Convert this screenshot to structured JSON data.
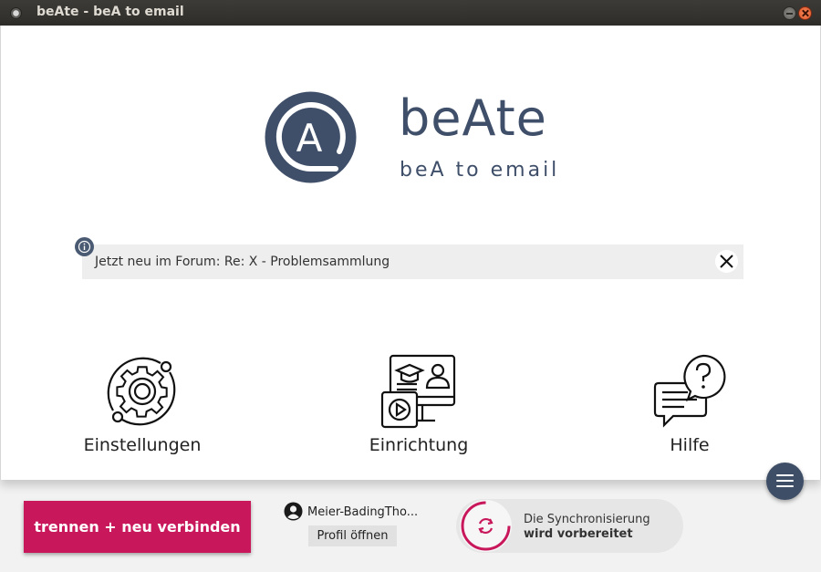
{
  "window": {
    "title": "beAte - beA to email"
  },
  "brand": {
    "name": "beAte",
    "tagline": "beA to email",
    "logo_letter": "A",
    "color": "#3f4f69"
  },
  "news": {
    "text": "Jetzt neu im Forum: Re: X - Problemsammlung",
    "info_icon": "info-icon",
    "close_icon": "close-icon"
  },
  "tiles": [
    {
      "label": "Einstellungen",
      "icon": "gear-icon"
    },
    {
      "label": "Einrichtung",
      "icon": "tutorial-icon"
    },
    {
      "label": "Hilfe",
      "icon": "help-chat-icon"
    }
  ],
  "menu_fab": {
    "icon": "hamburger-menu-icon"
  },
  "footer": {
    "disconnect_label": "trennen + neu verbinden",
    "user_name": "Meier-BadingTho...",
    "profile_label": "Profil öffnen",
    "sync_line1": "Die Synchronisierung",
    "sync_line2": "wird vorbereitet"
  },
  "colors": {
    "accent": "#c8185b",
    "brand": "#3f4f69",
    "footer_bg": "#f2f2f2"
  }
}
